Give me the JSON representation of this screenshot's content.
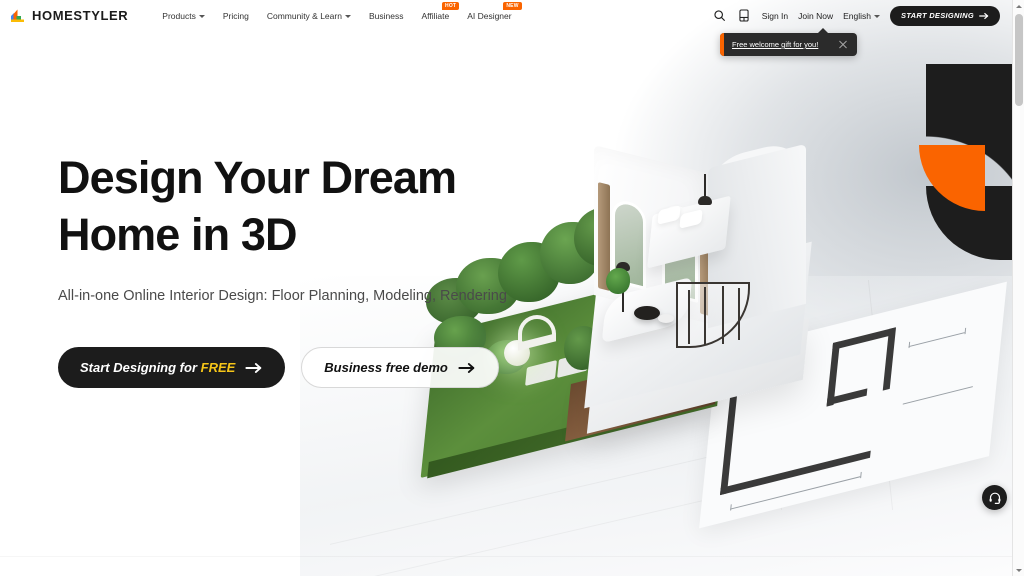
{
  "brand": {
    "name": "HOMESTYLER",
    "logo_icon": "homestyler-logo-icon",
    "logo_colors": [
      "#4285F4",
      "#FA6400",
      "#34A853",
      "#FBBC05"
    ]
  },
  "nav": {
    "items": [
      {
        "label": "Products",
        "has_dropdown": true,
        "badge": ""
      },
      {
        "label": "Pricing",
        "has_dropdown": false,
        "badge": ""
      },
      {
        "label": "Community & Learn",
        "has_dropdown": true,
        "badge": ""
      },
      {
        "label": "Business",
        "has_dropdown": false,
        "badge": ""
      },
      {
        "label": "Affiliate",
        "has_dropdown": false,
        "badge": "HOT"
      },
      {
        "label": "AI Designer",
        "has_dropdown": false,
        "badge": "NEW"
      }
    ],
    "search_icon": "search-icon",
    "app_icon": "mobile-app-icon",
    "sign_in": "Sign In",
    "join_now": "Join Now",
    "language": "English",
    "cta": "START DESIGNING"
  },
  "tooltip": {
    "text": "Free welcome gift for you!",
    "close_icon": "close-icon",
    "accent_color": "#FA6400"
  },
  "hero": {
    "title_line1": "Design Your Dream",
    "title_line2": "Home in 3D",
    "subtitle": "All-in-one Online Interior Design: Floor Planning, Modeling, Rendering",
    "cta_primary_prefix": "Start Designing for ",
    "cta_primary_highlight": "FREE",
    "cta_primary_highlight_color": "#F5C518",
    "cta_secondary": "Business free demo",
    "arrow_icon": "arrow-right-icon"
  },
  "support": {
    "icon": "headset-support-icon",
    "label": "Support"
  },
  "decor": {
    "black_shape_color": "#1d1d1d",
    "orange_shape_color": "#FA6400"
  },
  "scrollbar": {
    "up_icon": "scroll-up-arrow-icon",
    "down_icon": "scroll-down-arrow-icon",
    "thumb": "scrollbar-thumb"
  }
}
